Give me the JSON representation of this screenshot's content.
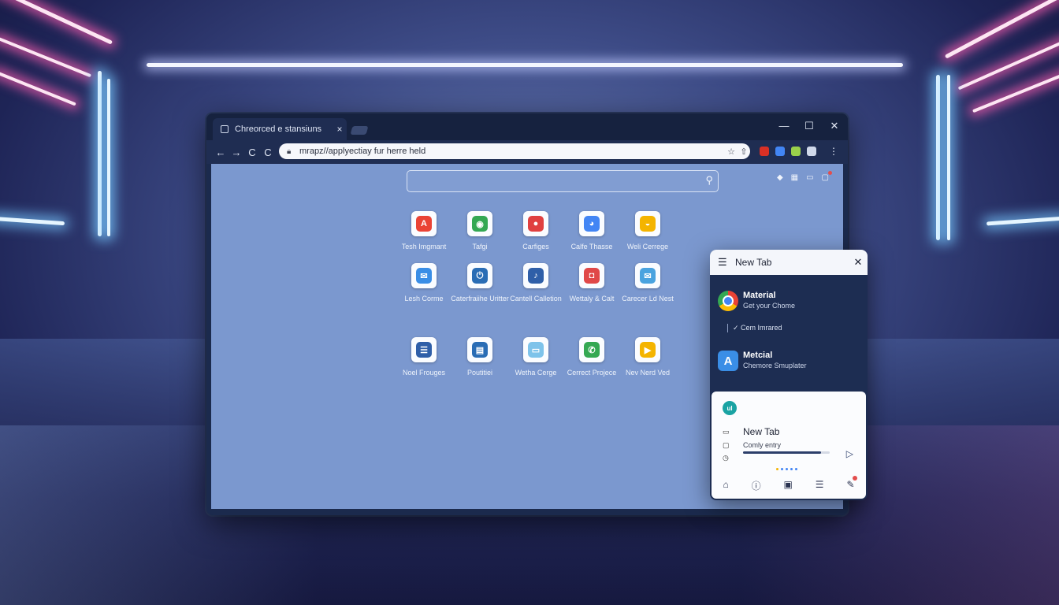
{
  "browser": {
    "tab_title": "Chreorced e stansiuns",
    "tab_close": "×",
    "window_controls": [
      "—",
      "☐",
      "✕"
    ],
    "url": "mrapz//applyectiay fur herre held",
    "nav": {
      "back": "←",
      "forward": "→",
      "reload": "C",
      "home": "C"
    }
  },
  "apps": [
    {
      "label": "Tesh Imgmant",
      "glyph": "A",
      "color": "#ea4335"
    },
    {
      "label": "Tafgi",
      "glyph": "◉",
      "color": "#34a853"
    },
    {
      "label": "Carfiges",
      "glyph": "●",
      "color": "#e04040"
    },
    {
      "label": "Calfe Thasse",
      "glyph": "◕",
      "color": "#4285f4"
    },
    {
      "label": "Weli Cerrege",
      "glyph": "◒",
      "color": "#f4b400"
    },
    {
      "label": "Lesh Corme",
      "glyph": "✉",
      "color": "#3a8ee6"
    },
    {
      "label": "Caterfraiihe Uritter",
      "glyph": "⏻",
      "color": "#2a6db5"
    },
    {
      "label": "Cantell Calletion",
      "glyph": "♪",
      "color": "#2f5fa8"
    },
    {
      "label": "Wettaly & Calt",
      "glyph": "◘",
      "color": "#e04848"
    },
    {
      "label": "Carecer Ld Nest",
      "glyph": "✉",
      "color": "#4aa3df"
    },
    {
      "label": "Noel Frouges",
      "glyph": "☰",
      "color": "#2f5fa8"
    },
    {
      "label": "Poutitiei",
      "glyph": "▤",
      "color": "#2a6db5"
    },
    {
      "label": "Wetha Cerge",
      "glyph": "▭",
      "color": "#7ec3ea"
    },
    {
      "label": "Cerrect Projece",
      "glyph": "✆",
      "color": "#34a853"
    },
    {
      "label": "Nev Nerd Ved",
      "glyph": "▶",
      "color": "#f4b400"
    }
  ],
  "panel": {
    "title": "New Tab",
    "item1": {
      "name": "Material",
      "sub": "Get your Chome"
    },
    "subrow": "Cem Imrared",
    "item2": {
      "name": "Metcial",
      "sub": "Chemore Smuplater",
      "glyph": "A"
    },
    "card": {
      "badge": "ul",
      "title": "New Tab",
      "caption": "Comly entry",
      "progress": 0.9
    }
  },
  "colors": {
    "accent": "#2c3e6a",
    "content_bg": "#7b98cf"
  }
}
